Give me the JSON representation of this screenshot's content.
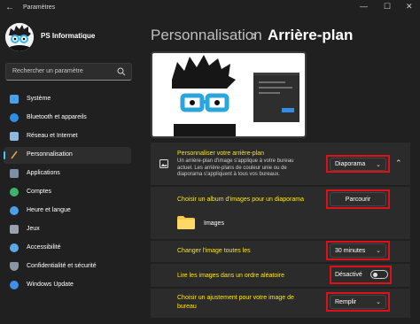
{
  "window": {
    "title": "Paramètres",
    "back_icon": "←",
    "minimize": "—",
    "maximize": "☐",
    "close": "✕"
  },
  "profile": {
    "name": "PS Informatique"
  },
  "search": {
    "placeholder": "Rechercher un paramètre"
  },
  "sidebar": {
    "items": [
      {
        "label": "Système",
        "icon": "system-icon",
        "color": "#4aa0e8"
      },
      {
        "label": "Bluetooth et appareils",
        "icon": "bluetooth-icon",
        "color": "#2f8de4"
      },
      {
        "label": "Réseau et Internet",
        "icon": "network-icon",
        "color": "#8fb8de"
      },
      {
        "label": "Personnalisation",
        "icon": "brush-icon",
        "color": "#e8a24a",
        "active": true
      },
      {
        "label": "Applications",
        "icon": "apps-icon",
        "color": "#7c8fa6"
      },
      {
        "label": "Comptes",
        "icon": "accounts-icon",
        "color": "#3db36b"
      },
      {
        "label": "Heure et langue",
        "icon": "clock-icon",
        "color": "#4aa0e8"
      },
      {
        "label": "Jeux",
        "icon": "games-icon",
        "color": "#9aa3ad"
      },
      {
        "label": "Accessibilité",
        "icon": "accessibility-icon",
        "color": "#5aa9e6"
      },
      {
        "label": "Confidentialité et sécurité",
        "icon": "shield-icon",
        "color": "#8a96a3"
      },
      {
        "label": "Windows Update",
        "icon": "update-icon",
        "color": "#3f8ee8"
      }
    ]
  },
  "header": {
    "parent": "Personnalisation",
    "separator": "›",
    "current": "Arrière-plan"
  },
  "background": {
    "title": "Personnaliser votre arrière-plan",
    "description_line1": "Un arrière-plan d'image s'applique à votre bureau",
    "description_line2": "actuel. Les arrière-plans de couleur unie ou de",
    "description_line3": "diaporama s'appliquent à tous vos bureaux.",
    "type_value": "Diaporama",
    "expand_icon": "⌃"
  },
  "album": {
    "label": "Choisir un album d'images pour un diaporama",
    "button": "Parcourir",
    "folder_name": "Images"
  },
  "interval": {
    "label": "Changer l'image toutes les",
    "value": "30 minutes"
  },
  "shuffle": {
    "label": "Lire les images dans un ordre aléatoire",
    "state": "Désactivé"
  },
  "fit": {
    "label_line1": "Choisir un ajustement pour votre image de",
    "label_line2": "bureau",
    "value": "Remplir"
  },
  "colors": {
    "accent": "#4cc2ff",
    "highlight": "#e0101a",
    "label_yellow": "#ffe800"
  }
}
